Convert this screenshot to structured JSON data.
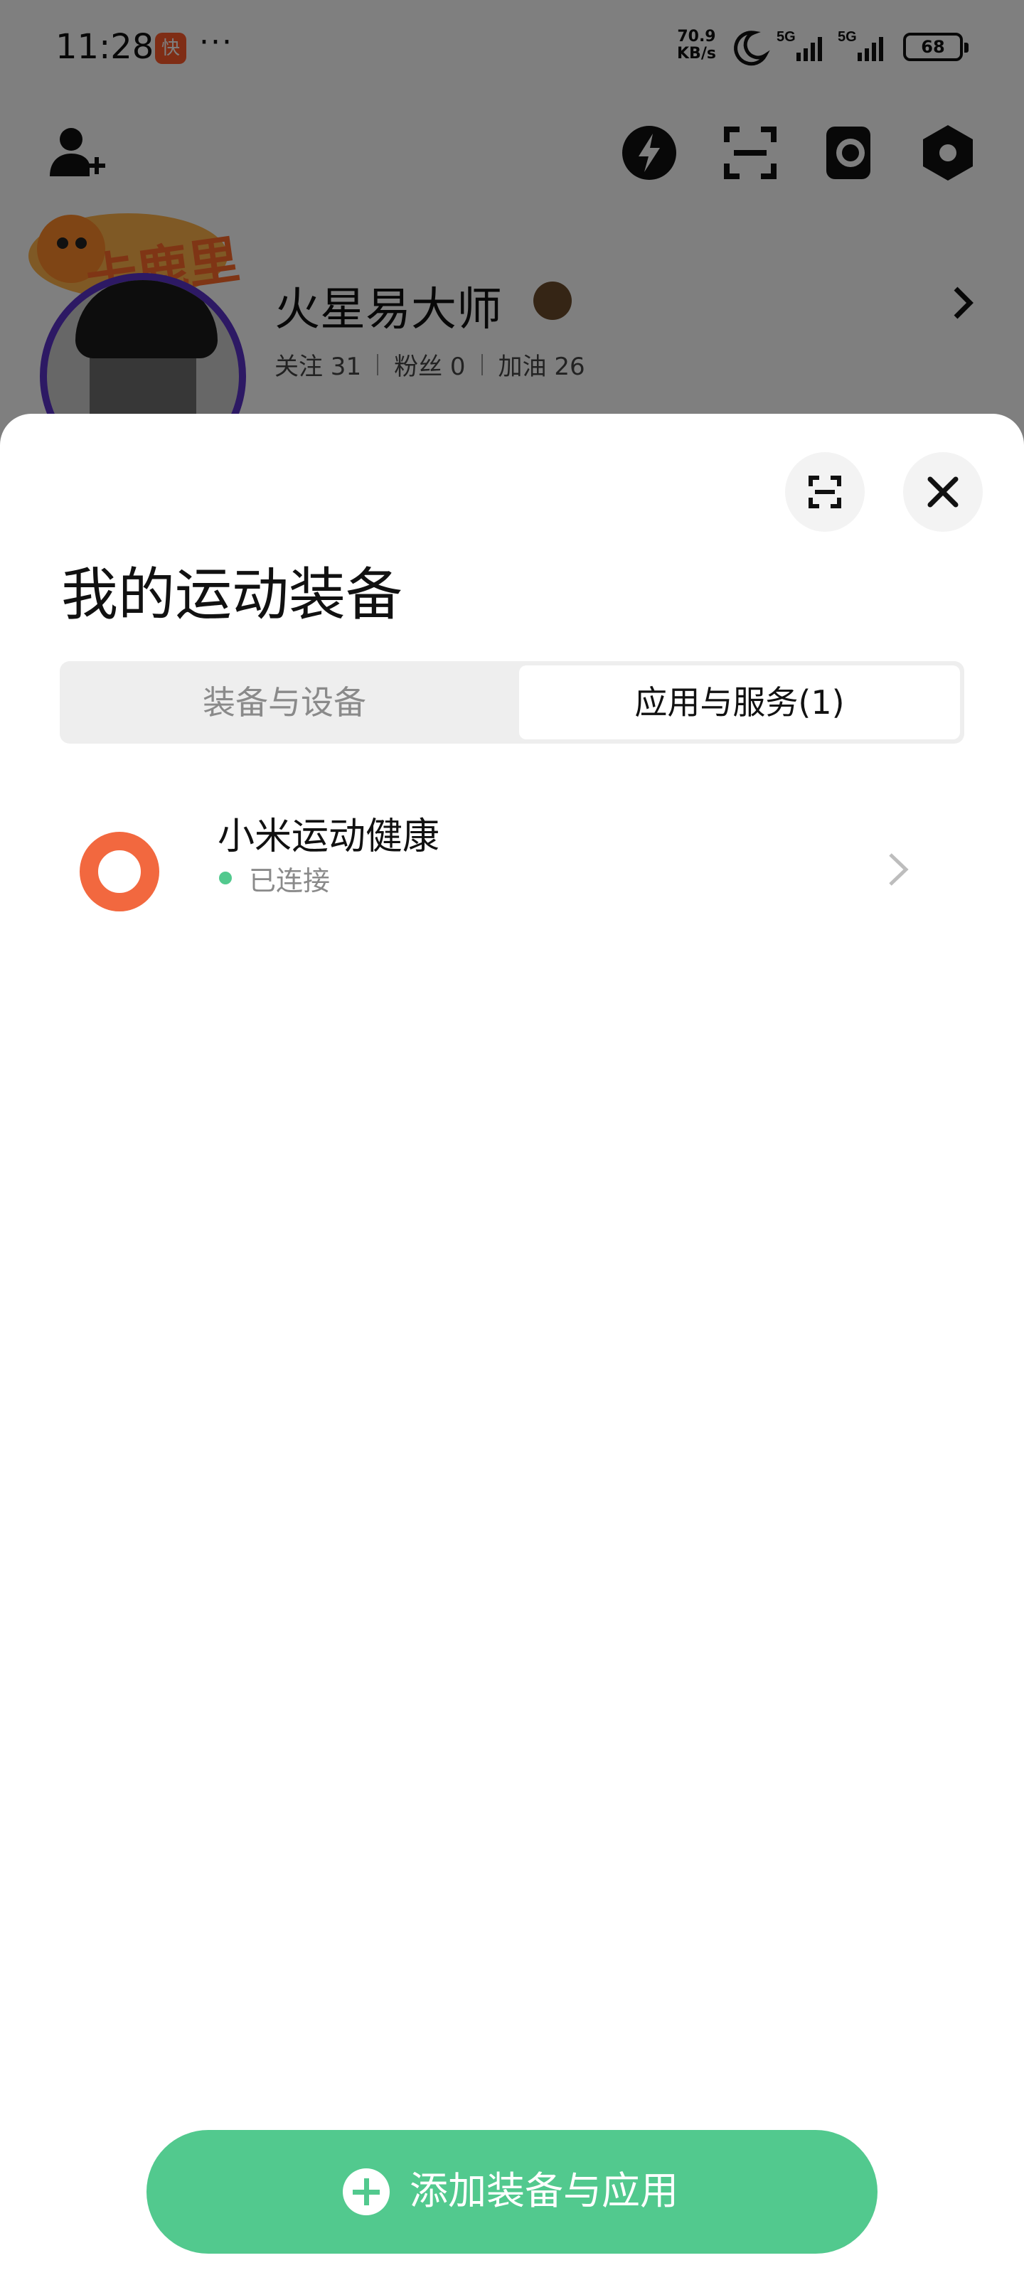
{
  "status_bar": {
    "time": "11:28",
    "app_icon": "kuaishou-icon",
    "more": "···",
    "net_speed_value": "70.9",
    "net_speed_unit": "KB/s",
    "sim1": "5G",
    "sim2": "5G",
    "battery": "68"
  },
  "profile": {
    "name": "火星易大师",
    "decoration_text": "卡鹿里",
    "stats": {
      "following_label": "关注 31",
      "fans_label": "粉丝 0",
      "cheer_label": "加油 26"
    }
  },
  "top_icons": [
    "add-user-icon",
    "flash-icon",
    "scan-icon",
    "watch-icon",
    "settings-icon"
  ],
  "sheet": {
    "title": "我的运动装备",
    "tabs": [
      {
        "label": "装备与设备",
        "active": false
      },
      {
        "label": "应用与服务(1)",
        "active": true
      }
    ],
    "apps": [
      {
        "name": "小米运动健康",
        "status": "已连接",
        "icon": "mi-health-ring-icon",
        "status_color": "#52c98e",
        "icon_color": "#f2683f"
      }
    ],
    "add_button_label": "添加装备与应用"
  },
  "colors": {
    "accent_green": "#52c98e",
    "app_orange": "#f2683f",
    "avatar_ring": "#5a32c8"
  }
}
